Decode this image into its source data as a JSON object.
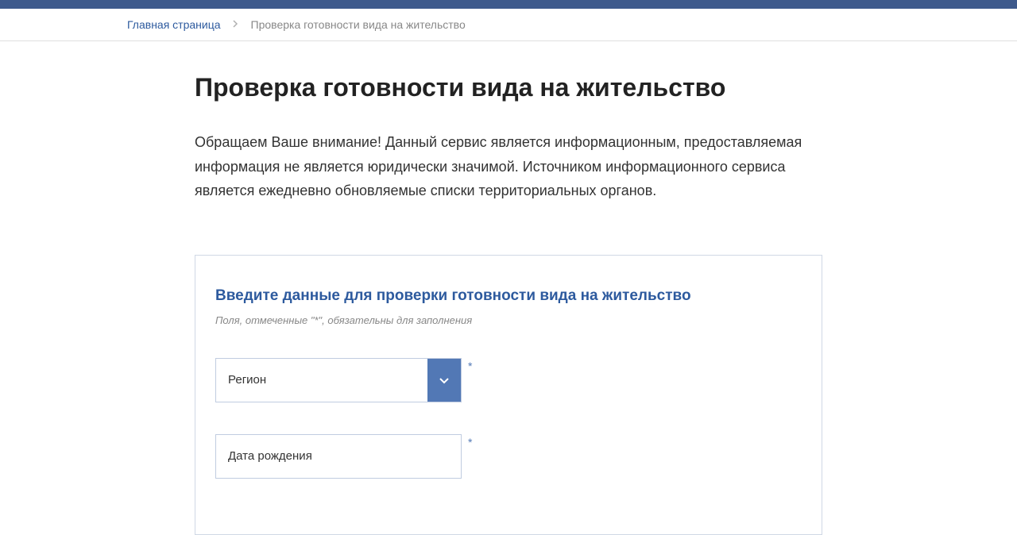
{
  "breadcrumb": {
    "home": "Главная страница",
    "current": "Проверка готовности вида на жительство"
  },
  "page": {
    "title": "Проверка готовности вида на жительство",
    "description": "Обращаем Ваше внимание! Данный сервис является информационным, предоставляемая информация не является юридически значимой. Источником информационного сервиса является ежедневно обновляемые списки территориальных органов."
  },
  "form": {
    "title": "Введите данные для проверки готовности вида на жительство",
    "note": "Поля, отмеченные \"*\", обязательны для заполнения",
    "region": {
      "label": "Регион"
    },
    "birthdate": {
      "placeholder": "Дата рождения"
    },
    "required_mark": "*"
  }
}
